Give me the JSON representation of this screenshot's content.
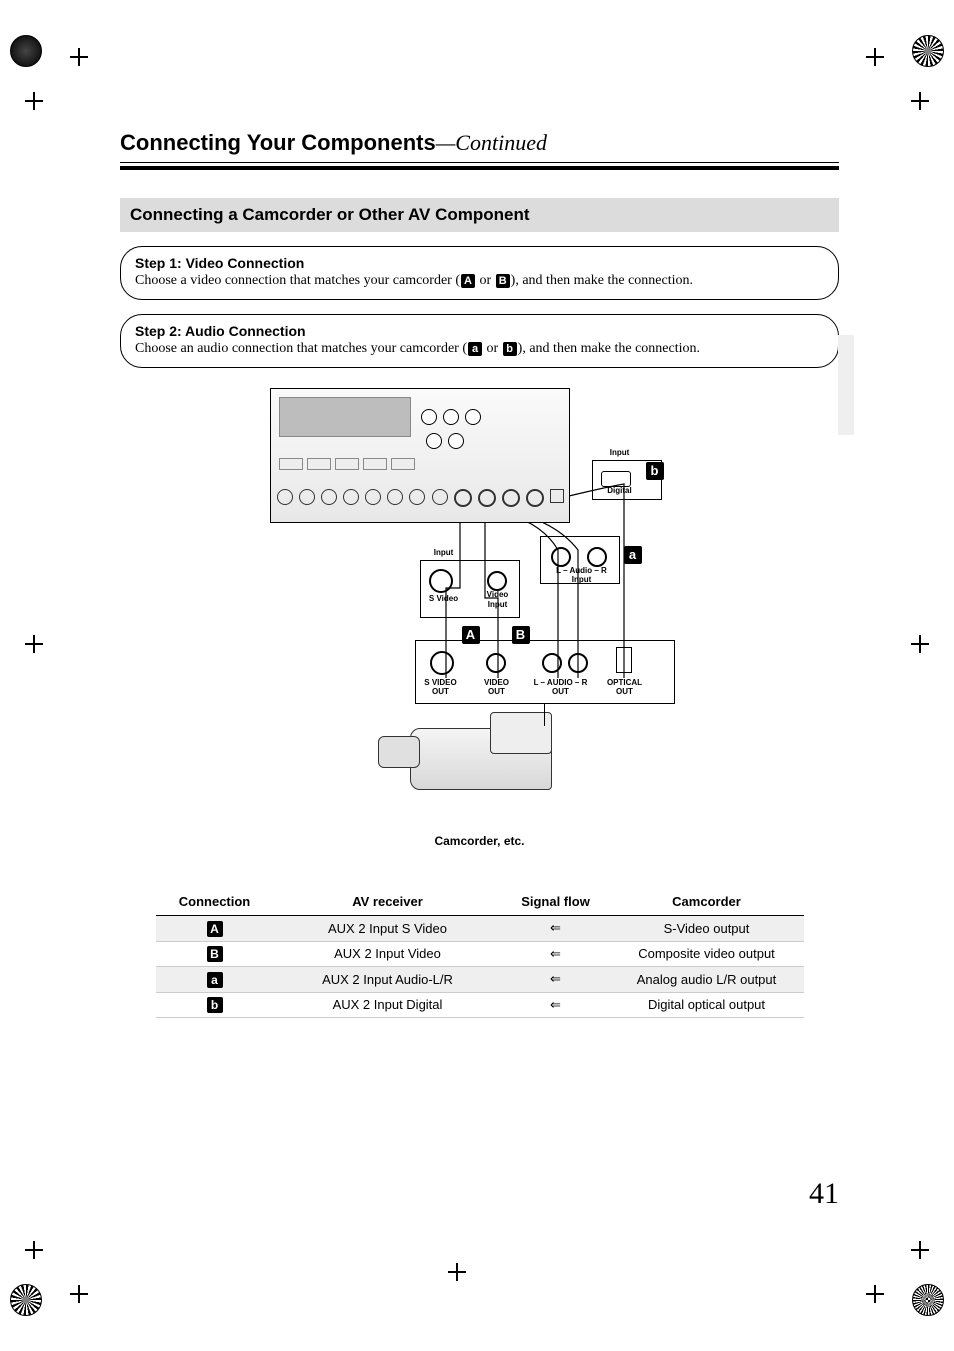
{
  "header": {
    "title": "Connecting Your Components",
    "continued": "—Continued"
  },
  "section_title": "Connecting a Camcorder or Other AV Component",
  "steps": [
    {
      "title": "Step 1: Video Connection",
      "body_before": "Choose a video connection that matches your camcorder (",
      "opt1": "A",
      "mid": " or ",
      "opt2": "B",
      "body_after": "), and then make the connection."
    },
    {
      "title": "Step 2: Audio Connection",
      "body_before": "Choose an audio connection that matches your camcorder (",
      "opt1": "a",
      "mid": " or ",
      "opt2": "b",
      "body_after": "), and then make the connection."
    }
  ],
  "diagram": {
    "caption": "Camcorder, etc.",
    "receiver_inputs": {
      "svideo": {
        "label_top": "Input",
        "label_bottom": "S Video",
        "badge": "A"
      },
      "video": {
        "label_top": "Video",
        "label_bottom": "Input",
        "badge": "B"
      },
      "audio": {
        "label": "L – Audio – R\nInput",
        "badge": "a"
      },
      "digital": {
        "label_top": "Input",
        "label_bottom": "Digital",
        "badge": "b"
      }
    },
    "camcorder_outputs": {
      "svideo": "S VIDEO\nOUT",
      "video": "VIDEO\nOUT",
      "audio": "L – AUDIO – R\nOUT",
      "optical": "OPTICAL\nOUT"
    }
  },
  "table": {
    "headers": [
      "Connection",
      "AV receiver",
      "Signal flow",
      "Camcorder"
    ],
    "rows": [
      {
        "badge": "A",
        "receiver": "AUX 2 Input S Video",
        "flow": "⇐",
        "camcorder": "S-Video output"
      },
      {
        "badge": "B",
        "receiver": "AUX 2 Input Video",
        "flow": "⇐",
        "camcorder": "Composite video output"
      },
      {
        "badge": "a",
        "receiver": "AUX 2 Input Audio-L/R",
        "flow": "⇐",
        "camcorder": "Analog audio L/R output"
      },
      {
        "badge": "b",
        "receiver": "AUX 2 Input Digital",
        "flow": "⇐",
        "camcorder": "Digital optical output"
      }
    ]
  },
  "page_number": "41"
}
